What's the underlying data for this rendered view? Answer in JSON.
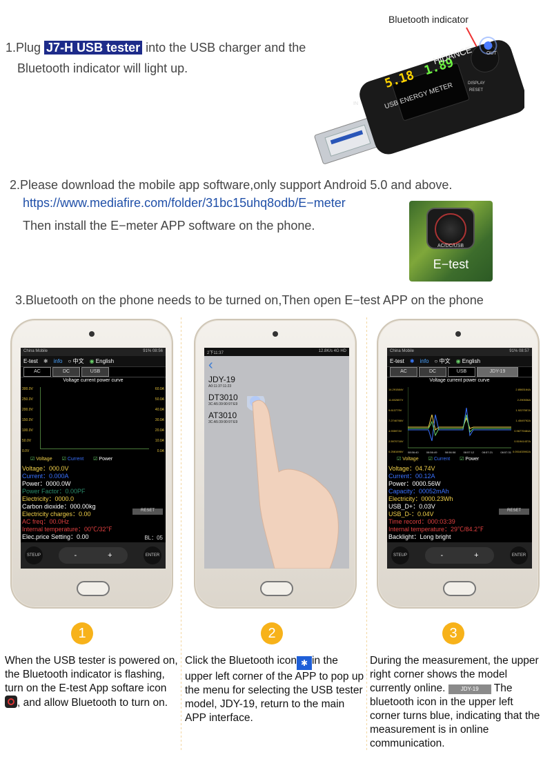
{
  "step1": {
    "prefix": "1.Plug ",
    "highlight": "J7-H USB tester",
    "suffix": " into the USB charger and the",
    "line2": "Bluetooth indicator will light up.",
    "callout": "Bluetooth indicator",
    "device": {
      "brand": "HiDANCE",
      "label": "USB ENERGY METER",
      "voltage": "5.18",
      "current": "1.89",
      "port_in": "IN",
      "port_out": "OUT",
      "btn_top": "DISPLAY",
      "btn_reset": "RESET"
    }
  },
  "step2": {
    "line1": "2.Please download the mobile app software,only support Android 5.0 and above.",
    "link": "https://www.mediafire.com/folder/31bc15uhq8odb/E−meter",
    "line3": "Then install the E−meter APP software on the phone.",
    "app_tile_label": "E−test",
    "app_tile_sub": "AC/DC/USB"
  },
  "step3": {
    "line": "3.Bluetooth on the phone needs to be turned on,Then open E−test APP on the phone"
  },
  "phones": [
    {
      "status_left": "China Mobile",
      "status_right": "91% 08:56",
      "app": "E-test",
      "info": "info",
      "lang1": "中文",
      "lang2": "English",
      "tabs": [
        "AC",
        "DC",
        "USB"
      ],
      "chart_title": "Voltage current power curve",
      "left_axis": [
        "300.0V",
        "250.0V",
        "200.0V",
        "150.0V",
        "100.0V",
        "50.0V",
        "0.0V"
      ],
      "right_axis": [
        "60.0A",
        "50.0A",
        "40.0A",
        "30.0A",
        "20.0A",
        "10.0A",
        "0.0A"
      ],
      "legend": [
        "Voltage",
        "Current",
        "Power"
      ],
      "readings": [
        {
          "t": "Voltage：000.0V",
          "c": "#f2d14a"
        },
        {
          "t": "Current：0.000A",
          "c": "#3a72ff"
        },
        {
          "t": "Power：0000.0W",
          "c": "#ffffff"
        },
        {
          "t": "Power Factor：0.00PF",
          "c": "#2a8a6a"
        },
        {
          "t": "Electricity：0000.0",
          "c": "#f2d14a"
        },
        {
          "t": "Carbon dioxide：000.00kg",
          "c": "#ffffff"
        },
        {
          "t": "Electricity charges：0.00",
          "c": "#f2d14a"
        },
        {
          "t": "AC freq：00.0Hz",
          "c": "#e04040"
        },
        {
          "t": "Internal temperature：00℃/32℉",
          "c": "#e04040"
        },
        {
          "t": "Elec.price Setting：0.00",
          "c": "#ffffff"
        }
      ],
      "reset": "RESET",
      "bl": "BL：05",
      "steup": "STEUP",
      "minus": "-",
      "plus": "+",
      "enter": "ENTER"
    },
    {
      "status_left": "2下11:37",
      "status_right": "12.8K/s 4G HD",
      "devices": [
        {
          "name": "JDY-19",
          "mac": "A0:11:37:11:23"
        },
        {
          "name": "DT3010",
          "mac": "3C:A5:39:90:97:E9"
        },
        {
          "name": "AT3010",
          "mac": "3C:A5:39:90:97:E9"
        }
      ]
    },
    {
      "status_left": "China Mobile",
      "status_right": "91% 08:57",
      "app": "E-test",
      "info": "info",
      "lang1": "中文",
      "lang2": "English",
      "tabs": [
        "AC",
        "DC",
        "USB",
        "JDY-19"
      ],
      "chart_title": "Voltage current power curve",
      "left_axis": [
        "14.291584V",
        "11.652657V",
        "9.613779V",
        "7.2746766V",
        "4.935974V",
        "2.5970716V",
        "0.2581696V"
      ],
      "right_axis": [
        "2.8583164A",
        "2.290536A",
        "1.9227557A",
        "1.4549792A",
        "0.98779484A",
        "0.51941437A",
        "0.051633902A"
      ],
      "x_ticks": [
        "08:56:40",
        "08:56:49",
        "08:56:58",
        "08:57:12",
        "08:57:21",
        "08:57:31"
      ],
      "legend": [
        "Voltage",
        "Current",
        "Power"
      ],
      "readings": [
        {
          "t": "Voltage：04.74V",
          "c": "#f2d14a"
        },
        {
          "t": "Current：00.12A",
          "c": "#3a72ff"
        },
        {
          "t": "Power：0000.56W",
          "c": "#ffffff"
        },
        {
          "t": "Capacity：00052mAh",
          "c": "#3a72ff"
        },
        {
          "t": "Electricity：0000.23Wh",
          "c": "#f2d14a"
        },
        {
          "t": "USB_D+：0.03V",
          "c": "#ffffff"
        },
        {
          "t": "USB_D-：0.04V",
          "c": "#f2d14a"
        },
        {
          "t": "Time record：000:03:39",
          "c": "#e04040"
        },
        {
          "t": "Internal temperature：29℃/84.2℉",
          "c": "#e04040"
        },
        {
          "t": "Backlight：Long bright",
          "c": "#ffffff"
        }
      ],
      "reset": "RESET",
      "steup": "STEUP",
      "minus": "-",
      "plus": "+",
      "enter": "ENTER"
    }
  ],
  "numbers": [
    "1",
    "2",
    "3"
  ],
  "captions": [
    "When the USB tester is powered on, the Bluetooth indicator is flashing, turn on the E-test App softare icon",
    ", and allow Bluetooth to turn on.",
    "Click the Bluetooth icon",
    "in the upper left corner of the APP to pop up the menu for selecting the USB tester model, JDY-19, return to the main APP interface.",
    "During the measurement, the upper right corner shows the model currently online.",
    "JDY-19",
    "The bluetooth icon in the upper left corner turns blue, indicating that the measurement is in online communication."
  ],
  "colors": {
    "accent": "#f7b21a",
    "highlight": "#1d2b8a",
    "link": "#1f4fa8"
  }
}
